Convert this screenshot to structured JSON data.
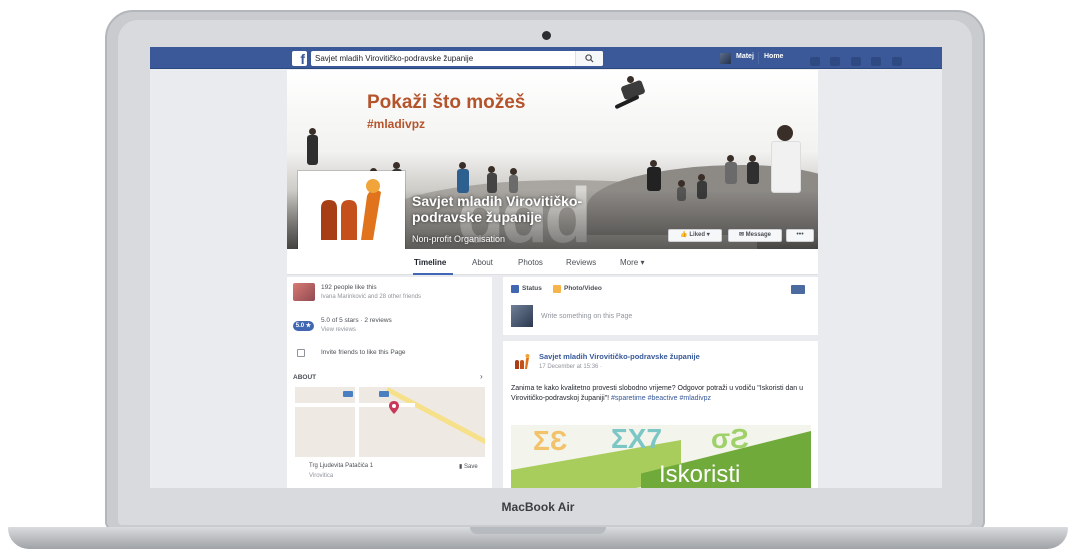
{
  "device": {
    "brand_label": "MacBook Air"
  },
  "topbar": {
    "search_value": "Savjet mladih Virovitičko-podravske županije",
    "user_name": "Matej",
    "home_label": "Home"
  },
  "cover": {
    "headline": "Pokaži što možeš",
    "hashtag": "#mladivpz",
    "page_name": "Savjet mladih Virovitičko-podravske županije",
    "category": "Non-profit Organisation",
    "liked_label": "Liked",
    "message_label": "Message",
    "more_label": "•••"
  },
  "tabs": [
    {
      "label": "Timeline",
      "active": true
    },
    {
      "label": "About",
      "active": false
    },
    {
      "label": "Photos",
      "active": false
    },
    {
      "label": "Reviews",
      "active": false
    },
    {
      "label": "More ▾",
      "active": false
    }
  ],
  "left": {
    "likes_text": "192 people like this",
    "friends_text": "Ivana Marinković and 28 other friends",
    "rating_badge": "5.0 ★",
    "rating_text": "5.0 of 5 stars · 2 reviews",
    "view_reviews": "View reviews",
    "invite_text": "Invite friends to like this Page",
    "about_label": "ABOUT",
    "address_line1": "Trg Ljudevita Patačića 1",
    "address_line2": "Virovitica",
    "save_label": "Save"
  },
  "composer": {
    "status_label": "Status",
    "photo_label": "Photo/Video",
    "placeholder": "Write something on this Page"
  },
  "post": {
    "author": "Savjet mladih Virovitičko-podravske županije",
    "date": "17 December at 15:36 ·",
    "text_main": "Zanima te kako kvalitetno provesti slobodno vrijeme? Odgovor potraži u vodiču \"Iskoristi dan u Virovitičko-podravskoj županiji\"!",
    "tags": "#sparetime #beactive #mladivpz",
    "image_word": "Iskoristi"
  },
  "colors": {
    "facebook_blue": "#3b5998",
    "link_blue": "#365899",
    "cover_orange": "#b5532b",
    "logo_orange": "#e0731c"
  }
}
